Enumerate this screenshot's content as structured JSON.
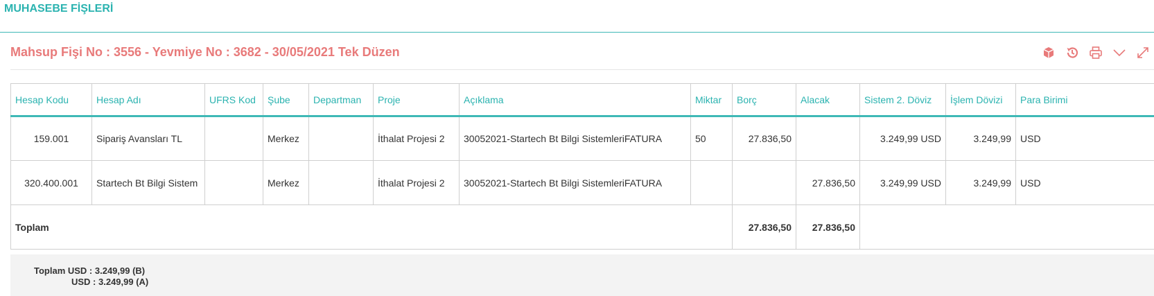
{
  "page": {
    "title": "MUHASEBE FİŞLERİ"
  },
  "voucher": {
    "title": "Mahsup Fişi No : 3556 - Yevmiye No : 3682 - 30/05/2021 Tek Düzen",
    "icons": [
      "box-icon",
      "history-icon",
      "print-icon",
      "chevron-down-icon",
      "expand-icon"
    ]
  },
  "colors": {
    "accent": "#2bb3b0",
    "title": "#e87a7a"
  },
  "table": {
    "headers": [
      "Hesap Kodu",
      "Hesap Adı",
      "UFRS Kod",
      "Şube",
      "Departman",
      "Proje",
      "Açıklama",
      "Miktar",
      "Borç",
      "Alacak",
      "Sistem 2. Döviz",
      "İşlem Dövizi",
      "Para Birimi"
    ],
    "rows": [
      [
        "159.001",
        "Sipariş Avansları TL",
        "",
        "Merkez",
        "",
        "İthalat Projesi 2",
        "30052021-Startech Bt Bilgi SistemleriFATURA",
        "50",
        "27.836,50",
        "",
        "3.249,99 USD",
        "3.249,99",
        "USD"
      ],
      [
        "320.400.001",
        "Startech Bt Bilgi Sistem",
        "",
        "Merkez",
        "",
        "İthalat Projesi 2",
        "30052021-Startech Bt Bilgi SistemleriFATURA",
        "",
        "",
        "27.836,50",
        "3.249,99 USD",
        "3.249,99",
        "USD"
      ]
    ],
    "total": {
      "label": "Toplam",
      "borc": "27.836,50",
      "alacak": "27.836,50"
    }
  },
  "summary": {
    "line1": "Toplam USD : 3.249,99 (B)",
    "line2": "USD : 3.249,99 (A)"
  }
}
